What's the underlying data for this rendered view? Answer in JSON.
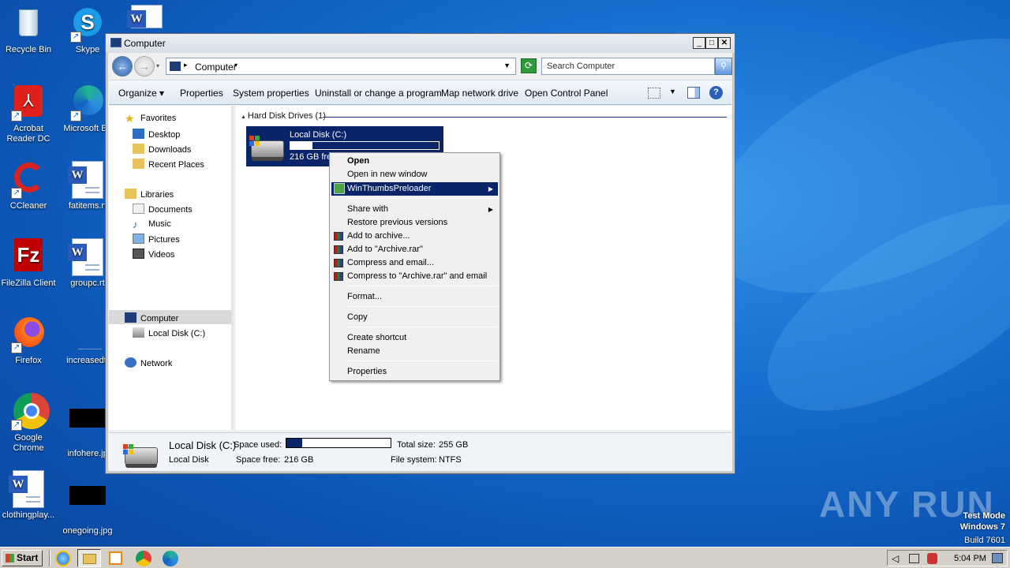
{
  "desktop": {
    "icons": [
      {
        "label": "Recycle Bin"
      },
      {
        "label": "Skype"
      },
      {
        "label": "Acrobat Reader DC",
        "l1": "Acrobat",
        "l2": "Reader DC"
      },
      {
        "label": "Microsoft Ed"
      },
      {
        "label": "CCleaner"
      },
      {
        "label": "fatitems.rt"
      },
      {
        "label": "FileZilla Client"
      },
      {
        "label": "groupc.rt"
      },
      {
        "label": "Firefox"
      },
      {
        "label": "increasedt."
      },
      {
        "label": "Google Chrome",
        "l1": "Google",
        "l2": "Chrome"
      },
      {
        "label": "infohere.jp"
      },
      {
        "label": "clothingplay..."
      },
      {
        "label": "onegoing.jpg"
      }
    ],
    "watermark": {
      "brand": "ANY RUN",
      "mode": "Test Mode",
      "os": "Windows 7",
      "build": "Build 7601"
    }
  },
  "window": {
    "title": "Computer",
    "address": "Computer",
    "search_placeholder": "Search Computer",
    "toolbar": {
      "organize": "Organize",
      "properties": "Properties",
      "system_properties": "System properties",
      "uninstall": "Uninstall or change a program",
      "map_drive": "Map network drive",
      "control_panel": "Open Control Panel"
    },
    "nav": {
      "favorites": "Favorites",
      "desktop": "Desktop",
      "downloads": "Downloads",
      "recent": "Recent Places",
      "libraries": "Libraries",
      "documents": "Documents",
      "music": "Music",
      "pictures": "Pictures",
      "videos": "Videos",
      "computer": "Computer",
      "local_disk": "Local Disk (C:)",
      "network": "Network"
    },
    "content": {
      "group_title": "Hard Disk Drives (1)",
      "drive_name": "Local Disk (C:)",
      "drive_free": "216 GB fre",
      "drive_used_fraction": 0.15
    },
    "details": {
      "name": "Local Disk (C:)",
      "type": "Local Disk",
      "space_used_label": "Space used:",
      "space_free_label": "Space free:",
      "space_free": "216 GB",
      "total_size_label": "Total size:",
      "total_size": "255 GB",
      "fs_label": "File system:",
      "fs": "NTFS"
    }
  },
  "context_menu": {
    "open": "Open",
    "open_new": "Open in new window",
    "winthumbs": "WinThumbsPreloader",
    "share_with": "Share with",
    "restore": "Restore previous versions",
    "add_archive": "Add to archive...",
    "add_rar": "Add to \"Archive.rar\"",
    "compress_email": "Compress and email...",
    "compress_rar_email": "Compress to \"Archive.rar\" and email",
    "format": "Format...",
    "copy": "Copy",
    "create_shortcut": "Create shortcut",
    "rename": "Rename",
    "properties": "Properties"
  },
  "taskbar": {
    "start": "Start",
    "clock": "5:04 PM"
  },
  "colors": {
    "selection": "#0a246a",
    "desktop": "#1670cf"
  }
}
